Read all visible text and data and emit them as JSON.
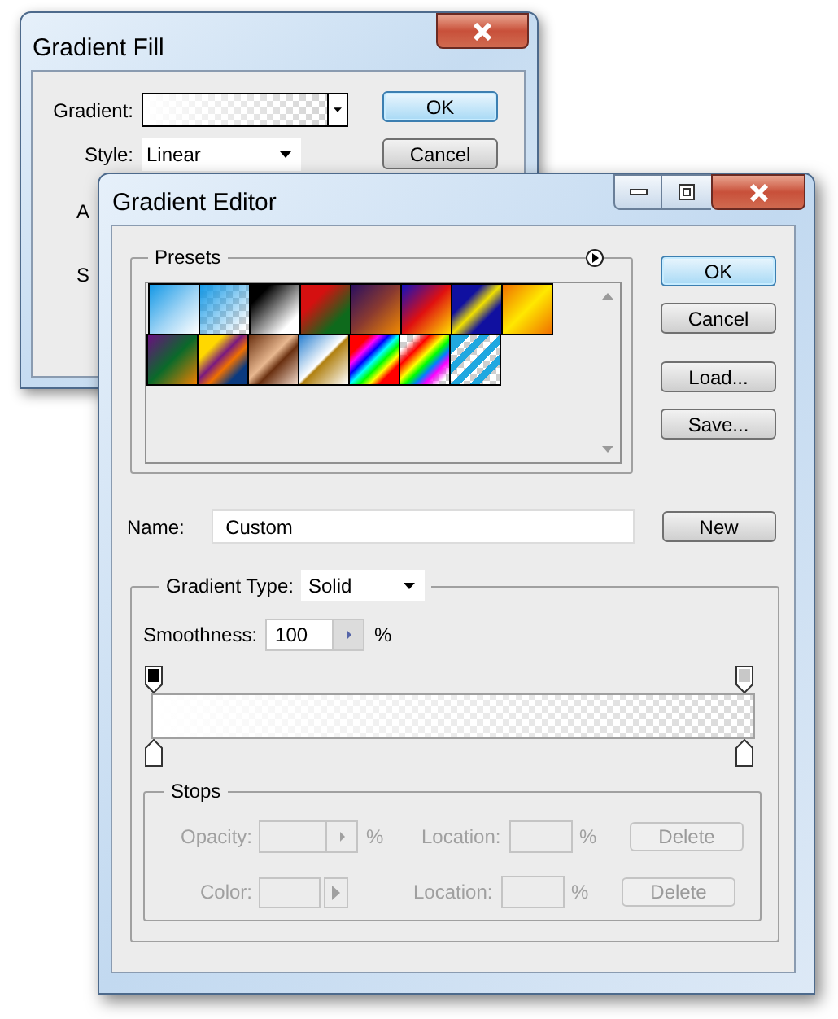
{
  "back_window": {
    "title": "Gradient Fill",
    "gradient_label": "Gradient:",
    "style": {
      "label": "Style:",
      "value": "Linear"
    },
    "cut_labels": [
      "A",
      "S"
    ],
    "buttons": [
      {
        "label": "OK",
        "default": true
      },
      {
        "label": "Cancel",
        "default": false
      }
    ]
  },
  "editor": {
    "title": "Gradient Editor",
    "presets": {
      "title": "Presets"
    },
    "buttons": [
      {
        "label": "OK",
        "default": true
      },
      {
        "label": "Cancel",
        "default": false
      },
      {
        "label": "Load...",
        "default": false
      },
      {
        "label": "Save...",
        "default": false
      }
    ],
    "name": {
      "label": "Name:",
      "value": "Custom"
    },
    "new_button": "New",
    "gradient_type": {
      "label": "Gradient Type:",
      "value": "Solid"
    },
    "smoothness": {
      "label": "Smoothness:",
      "value": "100",
      "unit": "%"
    },
    "stops": {
      "title": "Stops",
      "rows": [
        {
          "kind": "opacity",
          "label": "Opacity:",
          "unit": "%",
          "location_label": "Location:",
          "location_unit": "%",
          "button": "Delete",
          "disabled": true
        },
        {
          "kind": "color",
          "label": "Color:",
          "location_label": "Location:",
          "location_unit": "%",
          "button": "Delete",
          "disabled": true
        }
      ]
    }
  }
}
